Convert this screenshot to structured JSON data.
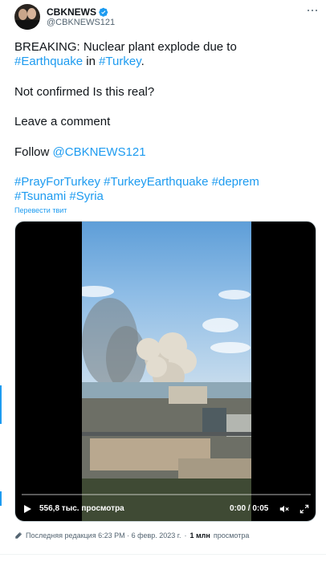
{
  "author": {
    "name": "CBKNEWS",
    "handle": "@CBKNEWS121"
  },
  "tweet": {
    "line1": "BREAKING: Nuclear plant explode due to",
    "line2_link1": "#Earthquake",
    "line2_mid": " in ",
    "line2_link2": "#Turkey",
    "line2_end": ".",
    "line3": "Not confirmed Is this real?",
    "line4": "Leave a comment",
    "line5_prefix": "Follow ",
    "line5_link": "@CBKNEWS121",
    "hashtags_line1": "#PrayForTurkey #TurkeyEarthquake #deprem",
    "hashtags_line2": "#Tsunami #Syria",
    "translate_label": "Перевести твит"
  },
  "video": {
    "views": "556,8 тыс. просмотра",
    "time": "0:00 / 0:05",
    "progress": 0
  },
  "meta": {
    "edited_label": "Последняя редакция 6:23 PM · 6 февр. 2023 г.",
    "separator": " · ",
    "views_count": "1 млн",
    "views_label": "просмотра"
  },
  "colors": {
    "accent": "#1d9bf0",
    "text": "#0f1419",
    "muted": "#536471"
  }
}
